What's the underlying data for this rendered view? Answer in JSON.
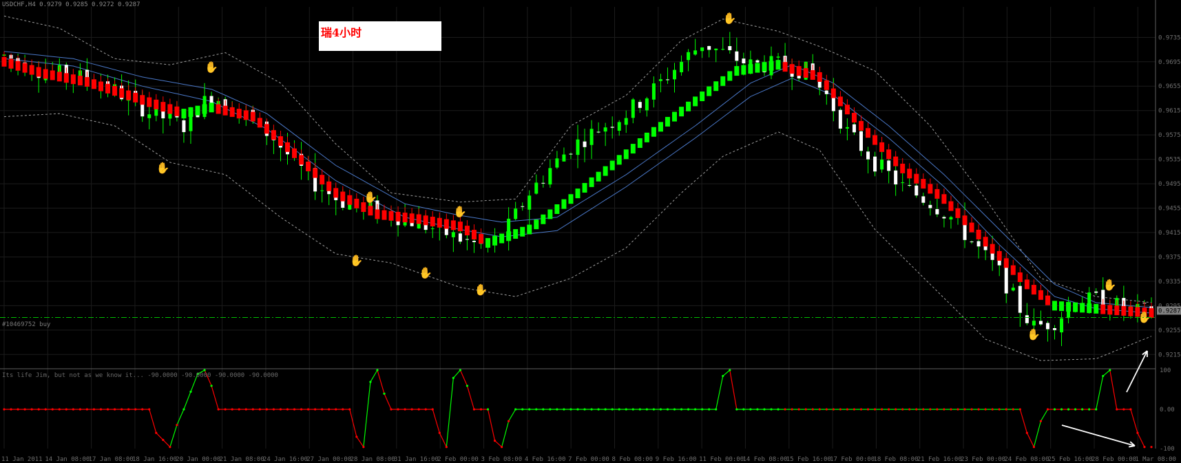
{
  "header": {
    "symbol_info": "USDCHF,H4  0.9279 0.9285 0.9272 0.9287"
  },
  "annotation": {
    "title": "瑞4小时"
  },
  "order_line": {
    "label": "#10469752 buy",
    "price": 0.9287
  },
  "subwindow": {
    "indicator_label": "Its life Jim, but not as we know it...  -90.0000 -90.0000 -90.0000 -90.0000"
  },
  "colors": {
    "background": "#000000",
    "up_candle": "#00ff00",
    "down_candle": "#ffffff",
    "trend_up": "#00ff00",
    "trend_down": "#ff0000",
    "ma_band": "#4a78c8",
    "envelope": "#a0a0a0",
    "order_line": "#00c000",
    "arrow": "#ffffff"
  },
  "chart_data": [
    {
      "type": "candlestick",
      "title": "USDCHF,H4",
      "price_axis_ticks": [
        "0.9735",
        "0.9695",
        "0.9655",
        "0.9615",
        "0.9575",
        "0.9535",
        "0.9495",
        "0.9455",
        "0.9415",
        "0.9375",
        "0.9335",
        "0.9295",
        "0.9255",
        "0.9215"
      ],
      "current_price_label": "0.9287",
      "ylim": [
        0.9195,
        0.9785
      ],
      "x_axis_labels": [
        "11 Jan 2011",
        "14 Jan 08:00",
        "17 Jan 08:00",
        "18 Jan 16:00",
        "20 Jan 00:00",
        "21 Jan 08:00",
        "24 Jan 16:00",
        "27 Jan 00:00",
        "28 Jan 08:00",
        "31 Jan 16:00",
        "2 Feb 00:00",
        "3 Feb 08:00",
        "4 Feb 16:00",
        "7 Feb 00:00",
        "8 Feb 08:00",
        "9 Feb 16:00",
        "11 Feb 00:00",
        "14 Feb 08:00",
        "15 Feb 16:00",
        "17 Feb 00:00",
        "18 Feb 08:00",
        "21 Feb 16:00",
        "23 Feb 00:00",
        "24 Feb 08:00",
        "25 Feb 16:00",
        "28 Feb 00:00",
        "1 Mar 08:00"
      ],
      "price_path": [
        [
          0,
          0.9705
        ],
        [
          3,
          0.969
        ],
        [
          6,
          0.9678
        ],
        [
          10,
          0.9672
        ],
        [
          14,
          0.9661
        ],
        [
          18,
          0.9635
        ],
        [
          21,
          0.9612
        ],
        [
          24,
          0.96
        ],
        [
          26,
          0.959
        ],
        [
          28,
          0.9618
        ],
        [
          30,
          0.964
        ],
        [
          33,
          0.9625
        ],
        [
          36,
          0.9598
        ],
        [
          39,
          0.957
        ],
        [
          42,
          0.953
        ],
        [
          45,
          0.9495
        ],
        [
          48,
          0.9472
        ],
        [
          50,
          0.946
        ],
        [
          53,
          0.9452
        ],
        [
          56,
          0.9445
        ],
        [
          60,
          0.943
        ],
        [
          63,
          0.9418
        ],
        [
          67,
          0.94
        ],
        [
          70,
          0.939
        ],
        [
          73,
          0.9425
        ],
        [
          76,
          0.948
        ],
        [
          79,
          0.952
        ],
        [
          82,
          0.9555
        ],
        [
          86,
          0.9585
        ],
        [
          90,
          0.961
        ],
        [
          94,
          0.965
        ],
        [
          98,
          0.9695
        ],
        [
          101,
          0.9725
        ],
        [
          104,
          0.971
        ],
        [
          108,
          0.969
        ],
        [
          112,
          0.969
        ],
        [
          116,
          0.968
        ],
        [
          119,
          0.964
        ],
        [
          122,
          0.958
        ],
        [
          126,
          0.953
        ],
        [
          130,
          0.949
        ],
        [
          134,
          0.9465
        ],
        [
          137,
          0.944
        ],
        [
          140,
          0.94
        ],
        [
          144,
          0.935
        ],
        [
          147,
          0.929
        ],
        [
          149,
          0.926
        ],
        [
          152,
          0.927
        ],
        [
          155,
          0.93
        ],
        [
          158,
          0.9305
        ],
        [
          161,
          0.9295
        ],
        [
          164,
          0.9285
        ],
        [
          166,
          0.9287
        ]
      ],
      "trend_path": [
        [
          0,
          0.9695
        ],
        [
          6,
          0.9675
        ],
        [
          12,
          0.9662
        ],
        [
          18,
          0.964
        ],
        [
          26,
          0.961
        ],
        [
          30,
          0.962
        ],
        [
          36,
          0.9605
        ],
        [
          42,
          0.9545
        ],
        [
          48,
          0.948
        ],
        [
          54,
          0.9445
        ],
        [
          60,
          0.9437
        ],
        [
          66,
          0.9425
        ],
        [
          70,
          0.9398
        ],
        [
          76,
          0.942
        ],
        [
          82,
          0.947
        ],
        [
          88,
          0.9525
        ],
        [
          94,
          0.958
        ],
        [
          100,
          0.963
        ],
        [
          106,
          0.968
        ],
        [
          112,
          0.969
        ],
        [
          118,
          0.967
        ],
        [
          124,
          0.959
        ],
        [
          130,
          0.952
        ],
        [
          136,
          0.947
        ],
        [
          142,
          0.94
        ],
        [
          148,
          0.933
        ],
        [
          152,
          0.9295
        ],
        [
          158,
          0.929
        ],
        [
          166,
          0.9283
        ]
      ],
      "trend_up_ranges": [
        [
          26,
          30
        ],
        [
          70,
          112
        ],
        [
          152,
          158
        ]
      ],
      "ma_band": [
        [
          0,
          0.9712,
          0.97
        ],
        [
          10,
          0.97,
          0.9688
        ],
        [
          20,
          0.967,
          0.9655
        ],
        [
          30,
          0.965,
          0.963
        ],
        [
          38,
          0.961,
          0.9585
        ],
        [
          48,
          0.9525,
          0.95
        ],
        [
          58,
          0.9462,
          0.944
        ],
        [
          66,
          0.9443,
          0.942
        ],
        [
          72,
          0.9432,
          0.9408
        ],
        [
          80,
          0.944,
          0.9418
        ],
        [
          90,
          0.951,
          0.949
        ],
        [
          100,
          0.959,
          0.957
        ],
        [
          108,
          0.966,
          0.9638
        ],
        [
          114,
          0.969,
          0.9668
        ],
        [
          120,
          0.966,
          0.964
        ],
        [
          128,
          0.959,
          0.957
        ],
        [
          136,
          0.951,
          0.949
        ],
        [
          144,
          0.942,
          0.9395
        ],
        [
          152,
          0.933,
          0.931
        ],
        [
          158,
          0.93,
          0.929
        ],
        [
          166,
          0.9292,
          0.9283
        ]
      ],
      "envelope": [
        [
          0,
          0.977,
          0.9605
        ],
        [
          8,
          0.975,
          0.961
        ],
        [
          16,
          0.97,
          0.959
        ],
        [
          24,
          0.969,
          0.953
        ],
        [
          32,
          0.971,
          0.951
        ],
        [
          40,
          0.966,
          0.944
        ],
        [
          48,
          0.956,
          0.938
        ],
        [
          56,
          0.948,
          0.9365
        ],
        [
          66,
          0.9465,
          0.9325
        ],
        [
          74,
          0.947,
          0.931
        ],
        [
          82,
          0.959,
          0.934
        ],
        [
          90,
          0.964,
          0.939
        ],
        [
          98,
          0.973,
          0.948
        ],
        [
          104,
          0.9765,
          0.954
        ],
        [
          112,
          0.9745,
          0.958
        ],
        [
          118,
          0.972,
          0.955
        ],
        [
          126,
          0.968,
          0.942
        ],
        [
          134,
          0.959,
          0.933
        ],
        [
          142,
          0.947,
          0.924
        ],
        [
          150,
          0.934,
          0.9205
        ],
        [
          158,
          0.931,
          0.9208
        ],
        [
          166,
          0.93,
          0.9245
        ]
      ],
      "sell_markers": [
        [
          30,
          0.968
        ],
        [
          53,
          0.9467
        ],
        [
          66,
          0.9443
        ],
        [
          105,
          0.976
        ],
        [
          160,
          0.9323
        ]
      ],
      "buy_markers": [
        [
          23,
          0.9515
        ],
        [
          51,
          0.9363
        ],
        [
          61,
          0.9343
        ],
        [
          69,
          0.9315
        ],
        [
          149,
          0.9242
        ],
        [
          165,
          0.927
        ]
      ]
    },
    {
      "type": "line",
      "title": "Its life Jim, but not as we know it...",
      "y_ticks": [
        "100",
        "0.00",
        "-100"
      ],
      "ylim": [
        -100,
        100
      ],
      "series": [
        {
          "values": [
            [
              0,
              0
            ],
            [
              21,
              0
            ],
            [
              22,
              -60
            ],
            [
              24,
              -96
            ],
            [
              25,
              -40
            ],
            [
              26,
              0
            ],
            [
              28,
              90
            ],
            [
              29,
              100
            ],
            [
              30,
              60
            ],
            [
              31,
              0
            ],
            [
              50,
              0
            ],
            [
              51,
              -70
            ],
            [
              52,
              -96
            ],
            [
              53,
              70
            ],
            [
              54,
              100
            ],
            [
              55,
              40
            ],
            [
              56,
              0
            ],
            [
              62,
              0
            ],
            [
              63,
              -60
            ],
            [
              64,
              -96
            ],
            [
              65,
              80
            ],
            [
              66,
              100
            ],
            [
              67,
              60
            ],
            [
              68,
              0
            ],
            [
              70,
              0
            ],
            [
              71,
              -80
            ],
            [
              72,
              -96
            ],
            [
              73,
              -30
            ],
            [
              74,
              0
            ],
            [
              103,
              0
            ],
            [
              104,
              85
            ],
            [
              105,
              100
            ],
            [
              106,
              0
            ],
            [
              147,
              0
            ],
            [
              148,
              -60
            ],
            [
              149,
              -96
            ],
            [
              150,
              -30
            ],
            [
              151,
              0
            ],
            [
              158,
              0
            ],
            [
              159,
              85
            ],
            [
              160,
              100
            ],
            [
              161,
              0
            ],
            [
              163,
              0
            ],
            [
              164,
              -60
            ],
            [
              165,
              -96
            ]
          ]
        }
      ]
    }
  ]
}
